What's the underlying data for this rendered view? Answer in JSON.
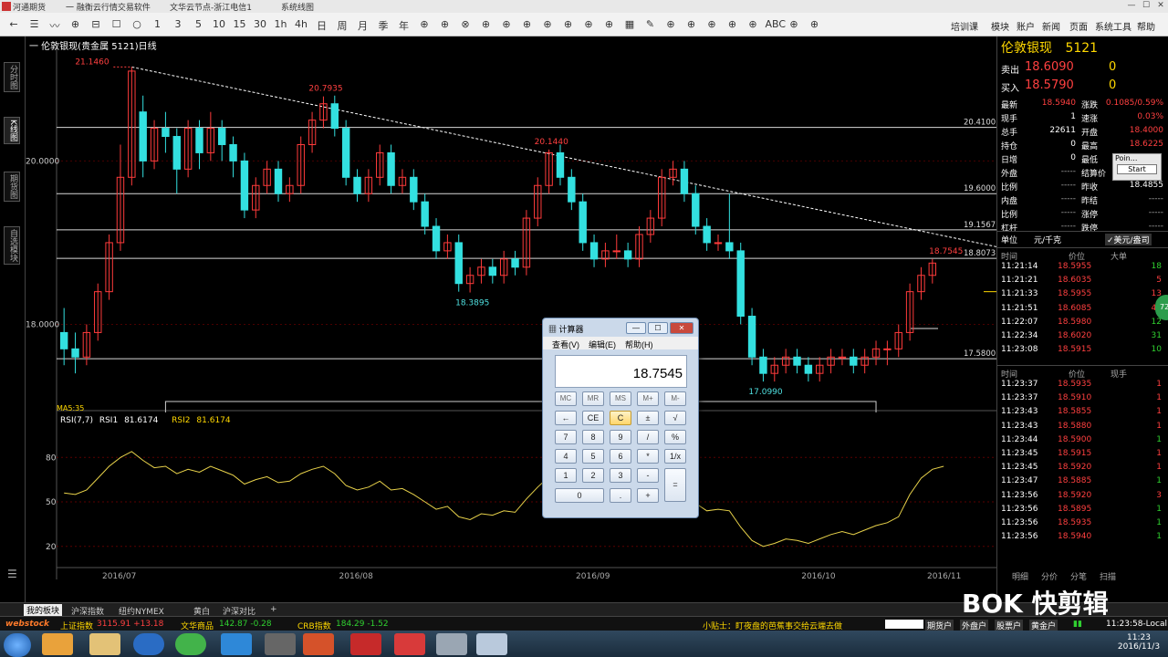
{
  "titlebar": {
    "app": "河通期货",
    "software": "一 融衡云行情交易软件",
    "news": "文华云节点-浙江电信1",
    "status": "系统线图"
  },
  "toolbar": {
    "tools": [
      "←",
      "☰",
      "〰",
      "⊕",
      "⊟",
      "☐",
      "○",
      "1",
      "3",
      "5",
      "10",
      "15",
      "30",
      "1h",
      "4h",
      "日",
      "周",
      "月",
      "季",
      "年",
      "⊕",
      "⊕",
      "⊗",
      "⊕",
      "⊕",
      "⊕",
      "⊕",
      "⊕",
      "⊕",
      "⊕",
      "▦",
      "✎",
      "⊕",
      "⊕",
      "⊕",
      "⊕",
      "⊕",
      "ABC",
      "⊕",
      "⊕"
    ],
    "menu": [
      "培训课",
      "模块",
      "账户",
      "新闻",
      "页面",
      "系统工具",
      "帮助"
    ]
  },
  "side_tabs": [
    "分时图",
    "K线图",
    "期货图",
    "自选模块"
  ],
  "chart": {
    "title": "一 伦敦银现(贵金属 5121)日线",
    "price_labels": [
      "20.0000",
      "18.0000"
    ],
    "hlines": [
      {
        "label": "20.4100",
        "value": 20.41
      },
      {
        "label": "19.6000",
        "value": 19.6
      },
      {
        "label": "19.1567",
        "value": 19.1567
      },
      {
        "label": "18.8073",
        "value": 18.8073
      },
      {
        "label": "17.5800",
        "value": 17.58
      }
    ],
    "annotations": [
      {
        "label": "21.1460",
        "color": "#ff4040"
      },
      {
        "label": "20.7935",
        "color": "#ff4040"
      },
      {
        "label": "20.1440",
        "color": "#ff4040"
      },
      {
        "label": "18.3895",
        "color": "#4fe0e0"
      },
      {
        "label": "17.0990",
        "color": "#4fe0e0"
      },
      {
        "label": "18.7545",
        "color": "#ff4040"
      }
    ],
    "ma_label": "MA5:35",
    "rsi_header": {
      "name": "RSI(7,7)",
      "rsi1_label": "RSI1",
      "rsi1": "81.6174",
      "rsi2_label": "RSI2",
      "rsi2": "81.6174"
    },
    "rsi_levels": [
      "80",
      "50",
      "20"
    ],
    "x_labels": [
      "2016/07",
      "2016/08",
      "2016/09",
      "2016/10",
      "2016/11"
    ]
  },
  "chart_data": {
    "type": "candlestick",
    "title": "伦敦银现(贵金属 5121)日线",
    "ylim": [
      17.0,
      21.3
    ],
    "x_labels": [
      "2016/07",
      "2016/08",
      "2016/09",
      "2016/10",
      "2016/11"
    ],
    "candles": [
      [
        17.9,
        17.7,
        18.2,
        17.5
      ],
      [
        17.7,
        17.6,
        17.9,
        17.4
      ],
      [
        17.6,
        17.9,
        18.0,
        17.5
      ],
      [
        17.9,
        18.4,
        18.5,
        17.8
      ],
      [
        18.4,
        19.0,
        19.1,
        18.3
      ],
      [
        19.0,
        19.8,
        20.2,
        18.9
      ],
      [
        19.8,
        21.1,
        21.15,
        19.7
      ],
      [
        20.6,
        20.0,
        20.8,
        19.8
      ],
      [
        20.0,
        20.4,
        20.5,
        19.9
      ],
      [
        20.4,
        20.3,
        20.6,
        20.1
      ],
      [
        20.3,
        19.9,
        20.4,
        19.6
      ],
      [
        19.9,
        20.4,
        20.5,
        19.8
      ],
      [
        20.4,
        20.1,
        20.5,
        19.9
      ],
      [
        20.1,
        20.4,
        20.6,
        20.0
      ],
      [
        20.4,
        20.2,
        20.5,
        20.0
      ],
      [
        20.2,
        20.0,
        20.3,
        19.8
      ],
      [
        20.0,
        19.4,
        20.1,
        19.3
      ],
      [
        19.4,
        19.7,
        19.8,
        19.3
      ],
      [
        19.7,
        19.9,
        20.0,
        19.6
      ],
      [
        19.9,
        19.6,
        20.0,
        19.5
      ],
      [
        19.6,
        19.7,
        19.8,
        19.5
      ],
      [
        19.7,
        20.2,
        20.3,
        19.6
      ],
      [
        20.2,
        20.5,
        20.6,
        20.1
      ],
      [
        20.5,
        20.7,
        20.79,
        20.4
      ],
      [
        20.7,
        20.4,
        20.8,
        20.3
      ],
      [
        20.4,
        19.8,
        20.5,
        19.7
      ],
      [
        19.8,
        19.6,
        19.9,
        19.5
      ],
      [
        19.6,
        19.8,
        19.9,
        19.5
      ],
      [
        19.8,
        20.1,
        20.2,
        19.7
      ],
      [
        20.1,
        19.7,
        20.2,
        19.6
      ],
      [
        19.7,
        19.8,
        19.9,
        19.6
      ],
      [
        19.8,
        19.5,
        19.9,
        19.4
      ],
      [
        19.5,
        19.2,
        19.6,
        19.1
      ],
      [
        19.2,
        18.9,
        19.3,
        18.8
      ],
      [
        18.9,
        19.0,
        19.1,
        18.8
      ],
      [
        19.0,
        18.5,
        19.1,
        18.4
      ],
      [
        18.5,
        18.6,
        18.7,
        18.39
      ],
      [
        18.6,
        18.7,
        18.8,
        18.5
      ],
      [
        18.7,
        18.6,
        18.8,
        18.5
      ],
      [
        18.6,
        18.8,
        18.9,
        18.5
      ],
      [
        18.8,
        18.7,
        18.9,
        18.6
      ],
      [
        18.7,
        19.3,
        19.4,
        18.6
      ],
      [
        19.3,
        19.7,
        19.8,
        19.2
      ],
      [
        19.7,
        20.1,
        20.14,
        19.6
      ],
      [
        20.1,
        19.8,
        20.2,
        19.7
      ],
      [
        19.8,
        19.5,
        19.9,
        19.4
      ],
      [
        19.5,
        19.0,
        19.6,
        18.9
      ],
      [
        19.0,
        18.8,
        19.1,
        18.7
      ],
      [
        18.8,
        18.9,
        19.0,
        18.7
      ],
      [
        18.9,
        18.9,
        19.1,
        18.8
      ],
      [
        18.9,
        18.8,
        19.0,
        18.7
      ],
      [
        18.8,
        19.1,
        19.2,
        18.7
      ],
      [
        19.1,
        19.3,
        19.4,
        19.0
      ],
      [
        19.3,
        19.8,
        19.9,
        19.2
      ],
      [
        19.8,
        19.9,
        20.0,
        19.7
      ],
      [
        19.9,
        19.6,
        20.0,
        19.5
      ],
      [
        19.6,
        19.2,
        19.7,
        19.1
      ],
      [
        19.2,
        19.0,
        19.3,
        18.9
      ],
      [
        19.0,
        19.0,
        19.1,
        18.9
      ],
      [
        19.0,
        18.9,
        19.6,
        18.8
      ],
      [
        18.9,
        18.1,
        19.0,
        18.0
      ],
      [
        18.1,
        17.6,
        18.2,
        17.5
      ],
      [
        17.6,
        17.4,
        17.7,
        17.3
      ],
      [
        17.4,
        17.5,
        17.6,
        17.3
      ],
      [
        17.5,
        17.6,
        17.7,
        17.4
      ],
      [
        17.6,
        17.5,
        17.7,
        17.4
      ],
      [
        17.5,
        17.4,
        17.6,
        17.3
      ],
      [
        17.4,
        17.5,
        17.6,
        17.3
      ],
      [
        17.5,
        17.6,
        17.7,
        17.4
      ],
      [
        17.6,
        17.6,
        17.7,
        17.5
      ],
      [
        17.6,
        17.5,
        17.7,
        17.4
      ],
      [
        17.5,
        17.6,
        17.7,
        17.4
      ],
      [
        17.6,
        17.7,
        17.8,
        17.5
      ],
      [
        17.7,
        17.7,
        17.8,
        17.5
      ],
      [
        17.7,
        17.9,
        18.0,
        17.6
      ],
      [
        17.9,
        18.4,
        18.5,
        17.8
      ],
      [
        18.4,
        18.6,
        18.7,
        18.3
      ],
      [
        18.6,
        18.75,
        18.8,
        18.5
      ]
    ],
    "rsi": [
      56,
      55,
      58,
      66,
      74,
      80,
      84,
      78,
      73,
      74,
      69,
      72,
      70,
      74,
      71,
      68,
      62,
      65,
      67,
      63,
      64,
      69,
      72,
      74,
      69,
      61,
      58,
      60,
      64,
      58,
      59,
      55,
      50,
      45,
      47,
      40,
      38,
      42,
      41,
      44,
      43,
      52,
      60,
      67,
      62,
      56,
      48,
      45,
      46,
      47,
      45,
      49,
      53,
      61,
      63,
      57,
      49,
      44,
      45,
      44,
      33,
      24,
      20,
      22,
      25,
      24,
      22,
      25,
      28,
      30,
      28,
      31,
      34,
      36,
      40,
      55,
      66,
      72,
      74
    ]
  },
  "quote": {
    "name": "伦敦银现",
    "code": "5121",
    "sell_label": "卖出",
    "sell_price": "18.6090",
    "sell_vol": "0",
    "buy_label": "买入",
    "buy_price": "18.5790",
    "buy_vol": "0",
    "rows": [
      {
        "l1": "最新",
        "v1": "18.5940",
        "c1": "red",
        "l2": "涨跌",
        "v2": "0.1085/0.59%",
        "c2": "red"
      },
      {
        "l1": "现手",
        "v1": "1",
        "c1": "white",
        "l2": "速涨",
        "v2": "0.03%",
        "c2": "red"
      },
      {
        "l1": "总手",
        "v1": "22611",
        "c1": "white",
        "l2": "开盘",
        "v2": "18.4000",
        "c2": "red"
      },
      {
        "l1": "持仓",
        "v1": "0",
        "c1": "white",
        "l2": "最高",
        "v2": "18.6225",
        "c2": "red"
      },
      {
        "l1": "日增",
        "v1": "0",
        "c1": "white",
        "l2": "最低",
        "v2": "",
        "c2": "red"
      },
      {
        "l1": "外盘",
        "v1": "-----",
        "c1": "gray",
        "l2": "结算价",
        "v2": "",
        "c2": "white"
      },
      {
        "l1": "比例",
        "v1": "-----",
        "c1": "gray",
        "l2": "昨收",
        "v2": "18.4855",
        "c2": "white"
      },
      {
        "l1": "内盘",
        "v1": "-----",
        "c1": "gray",
        "l2": "昨结",
        "v2": "-----",
        "c2": "gray"
      },
      {
        "l1": "比例",
        "v1": "-----",
        "c1": "gray",
        "l2": "涨停",
        "v2": "-----",
        "c2": "gray"
      },
      {
        "l1": "杠杆",
        "v1": "-----",
        "c1": "gray",
        "l2": "跌停",
        "v2": "-----",
        "c2": "gray"
      }
    ],
    "unit_label": "单位",
    "unit_value": "元/千克",
    "unit_alt": "✓美元/盎司",
    "popup": {
      "title": "Poin...",
      "button": "Start"
    },
    "ticks_header": [
      "时间",
      "价位",
      "大单"
    ],
    "ticks1": [
      {
        "t": "11:21:14",
        "p": "18.5955",
        "v": "18",
        "c": "green"
      },
      {
        "t": "11:21:21",
        "p": "18.6035",
        "v": "5",
        "c": "red"
      },
      {
        "t": "11:21:33",
        "p": "18.5955",
        "v": "13",
        "c": "red"
      },
      {
        "t": "11:21:51",
        "p": "18.6085",
        "v": "40",
        "c": "red"
      },
      {
        "t": "11:22:07",
        "p": "18.5980",
        "v": "12",
        "c": "green"
      },
      {
        "t": "11:22:34",
        "p": "18.6020",
        "v": "31",
        "c": "green"
      },
      {
        "t": "11:23:08",
        "p": "18.5915",
        "v": "10",
        "c": "green"
      }
    ],
    "ticks2_header": [
      "时间",
      "价位",
      "现手"
    ],
    "ticks2": [
      {
        "t": "11:23:37",
        "p": "18.5935",
        "v": "1",
        "c": "red"
      },
      {
        "t": "11:23:37",
        "p": "18.5910",
        "v": "1",
        "c": "red"
      },
      {
        "t": "11:23:43",
        "p": "18.5855",
        "v": "1",
        "c": "red"
      },
      {
        "t": "11:23:43",
        "p": "18.5880",
        "v": "1",
        "c": "red"
      },
      {
        "t": "11:23:44",
        "p": "18.5900",
        "v": "1",
        "c": "green"
      },
      {
        "t": "11:23:45",
        "p": "18.5915",
        "v": "1",
        "c": "red"
      },
      {
        "t": "11:23:45",
        "p": "18.5920",
        "v": "1",
        "c": "red"
      },
      {
        "t": "11:23:47",
        "p": "18.5885",
        "v": "1",
        "c": "green"
      },
      {
        "t": "11:23:56",
        "p": "18.5920",
        "v": "3",
        "c": "red"
      },
      {
        "t": "11:23:56",
        "p": "18.5895",
        "v": "1",
        "c": "green"
      },
      {
        "t": "11:23:56",
        "p": "18.5935",
        "v": "1",
        "c": "green"
      },
      {
        "t": "11:23:56",
        "p": "18.5940",
        "v": "1",
        "c": "green"
      }
    ],
    "bottom_tabs": [
      "明细",
      "分价",
      "分笔",
      "扫描"
    ]
  },
  "calculator": {
    "title": "计算器",
    "menu": [
      "查看(V)",
      "编辑(E)",
      "帮助(H)"
    ],
    "display": "18.7545",
    "keys": [
      [
        "MC",
        "MR",
        "MS",
        "M+",
        "M-"
      ],
      [
        "←",
        "CE",
        "C",
        "±",
        "√"
      ],
      [
        "7",
        "8",
        "9",
        "/",
        "%"
      ],
      [
        "4",
        "5",
        "6",
        "*",
        "1/x"
      ],
      [
        "1",
        "2",
        "3",
        "-",
        "="
      ],
      [
        "0",
        ".",
        "+"
      ]
    ]
  },
  "sheet_tabs": [
    "我的板块",
    "沪深指数",
    "纽约NYMEX",
    "黄白",
    "沪深对比",
    "+"
  ],
  "status": {
    "brand": "webstock",
    "idx1_name": "上证指数",
    "idx1_val": "3115.91 +13.18",
    "idx2_name": "文华商品",
    "idx2_val": "142.87 -0.28",
    "idx3_name": "CRB指数",
    "idx3_val": "184.29 -1.52",
    "tip": "小贴士：盯夜盘的芭蕉事交给云端去做",
    "btns": [
      "期货户",
      "外盘户",
      "股票户",
      "黄金户"
    ],
    "time": "11:23:58-Local"
  },
  "taskbar": {
    "clock_time": "11:23",
    "clock_date": "2016/11/3"
  },
  "watermark": "BOK 快剪辑",
  "float_badge": "72"
}
